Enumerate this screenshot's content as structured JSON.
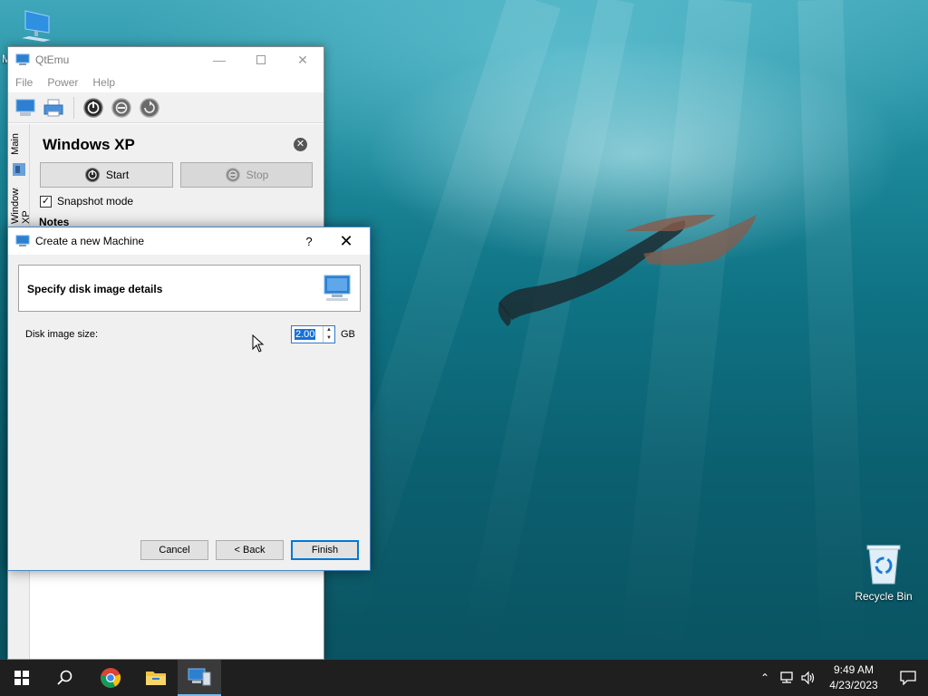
{
  "desktop": {
    "pc_icon_label": "M",
    "recycle_bin_label": "Recycle Bin"
  },
  "qtemu": {
    "title": "QtEmu",
    "menu": [
      "File",
      "Power",
      "Help"
    ],
    "toolbar": [
      "new-machine-icon",
      "printer-icon",
      "power-start-icon",
      "power-stop-icon",
      "power-reset-icon"
    ],
    "side_tabs": [
      "Main",
      "Windows XP"
    ],
    "machine_name": "Windows XP",
    "start_label": "Start",
    "stop_label": "Stop",
    "snapshot_label": "Snapshot mode",
    "snapshot_checked": true,
    "notes_label": "Notes"
  },
  "dialog": {
    "title": "Create a new Machine",
    "help": "?",
    "heading": "Specify disk image details",
    "disk_size_label": "Disk image size:",
    "disk_size_value": "2.00",
    "disk_size_unit": "GB",
    "cancel_label": "Cancel",
    "back_label": "< Back",
    "finish_label": "Finish"
  },
  "taskbar": {
    "time": "9:49 AM",
    "date": "4/23/2023",
    "items": [
      "start-icon",
      "search-icon",
      "chrome-icon",
      "file-explorer-icon",
      "qtemu-icon"
    ]
  },
  "colors": {
    "accent": "#0078d7",
    "selection": "#1570d8",
    "taskbar": "#1f1f1f"
  }
}
